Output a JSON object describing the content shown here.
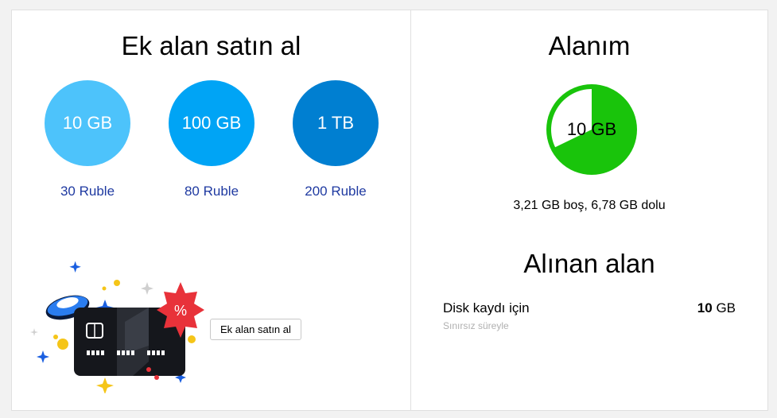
{
  "buy_section": {
    "title": "Ek alan satın al",
    "plans": [
      {
        "size": "10 GB",
        "price": "30 Ruble",
        "color": "#4dc3fb"
      },
      {
        "size": "100 GB",
        "price": "80 Ruble",
        "color": "#00a4f5"
      },
      {
        "size": "1 TB",
        "price": "200 Ruble",
        "color": "#007fd1"
      }
    ],
    "button_label": "Ek alan satın al",
    "promo_badge_text": "%"
  },
  "storage_section": {
    "title": "Alanım",
    "total_label": "10 GB",
    "used_fraction": 0.678,
    "used_color": "#19c40b",
    "usage_text": "3,21 GB boş, 6,78 GB dolu"
  },
  "acquired_section": {
    "title": "Alınan alan",
    "item_label": "Disk kaydı için",
    "item_sub": "Sınırsız süreyle",
    "item_value_number": "10",
    "item_value_unit": "GB"
  }
}
